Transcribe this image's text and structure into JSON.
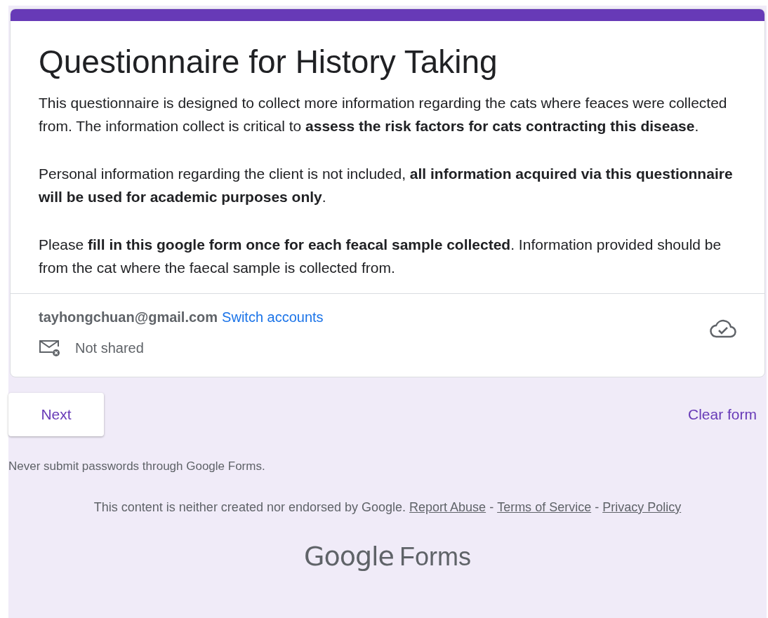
{
  "form": {
    "title": "Questionnaire for History Taking",
    "description": [
      "This questionnaire is designed to collect more information regarding the cats where feaces were collected from. The information collect is critical to **assess the risk factors for cats contracting this disease**.",
      "Personal information regarding the client is not included, **all information acquired via this questionnaire will be used for academic purposes only**.",
      "Please **fill in this google form once for each feacal sample collected**. Information provided should be from the cat where the faecal sample is collected from."
    ],
    "account": {
      "email": "tayhongchuan@gmail.com",
      "switch_link": "Switch accounts",
      "sharing": "Not shared"
    }
  },
  "actions": {
    "next": "Next",
    "clear": "Clear form"
  },
  "footer": {
    "warning": "Never submit passwords through Google Forms.",
    "disclaimer": "This content is neither created nor endorsed by Google.",
    "links": [
      "Report Abuse",
      "Terms of Service",
      "Privacy Policy"
    ],
    "separator": "-",
    "logo": {
      "brand": "Google",
      "product": "Forms"
    }
  }
}
